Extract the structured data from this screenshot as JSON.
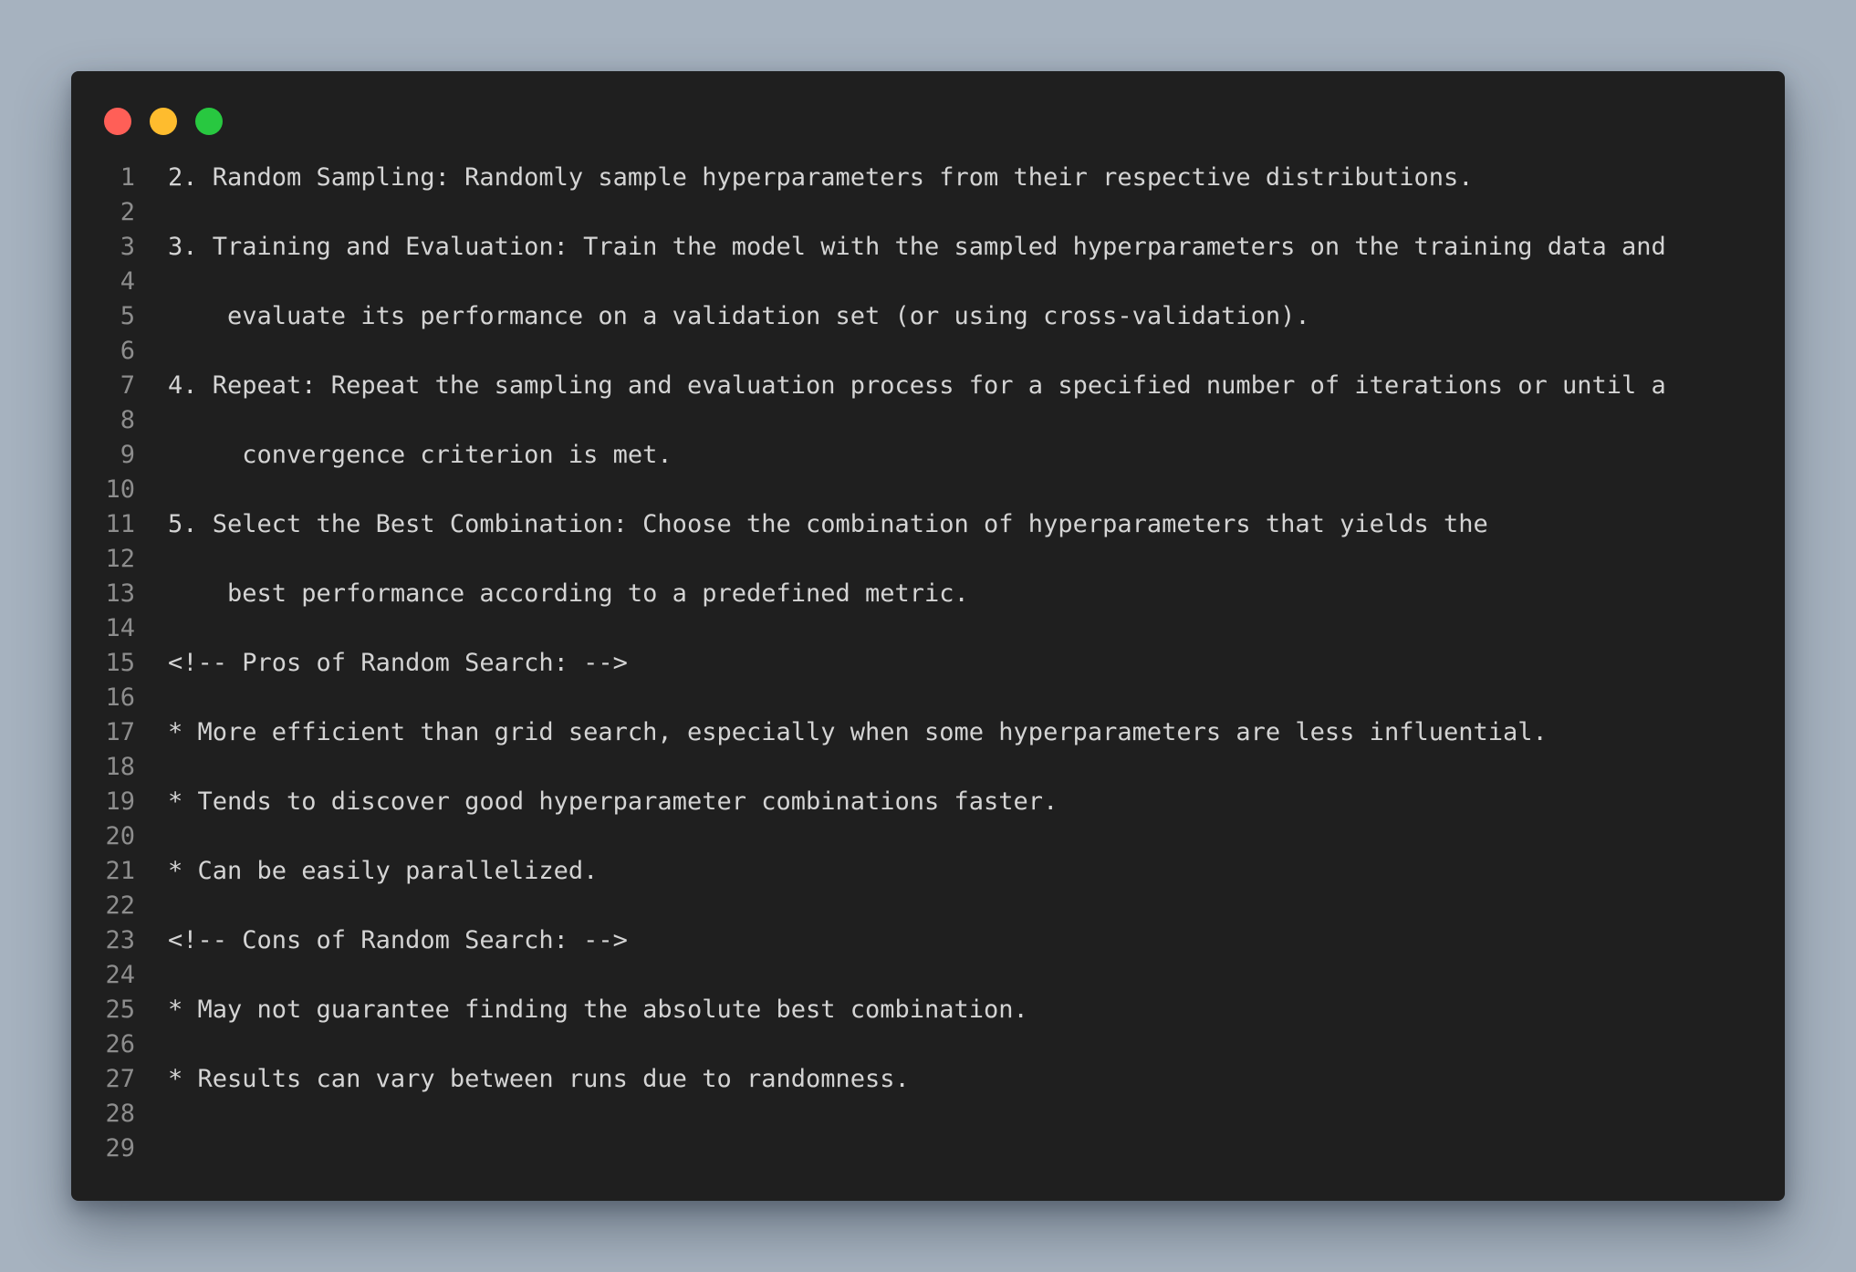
{
  "window": {
    "controls": [
      {
        "name": "close",
        "color": "#ff5f57"
      },
      {
        "name": "minimize",
        "color": "#febc2e"
      },
      {
        "name": "maximize",
        "color": "#28c840"
      }
    ]
  },
  "code": {
    "lines": [
      {
        "number": "1",
        "text": "2. Random Sampling: Randomly sample hyperparameters from their respective distributions."
      },
      {
        "number": "2",
        "text": ""
      },
      {
        "number": "3",
        "text": "3. Training and Evaluation: Train the model with the sampled hyperparameters on the training data and"
      },
      {
        "number": "4",
        "text": ""
      },
      {
        "number": "5",
        "text": "    evaluate its performance on a validation set (or using cross-validation)."
      },
      {
        "number": "6",
        "text": ""
      },
      {
        "number": "7",
        "text": "4. Repeat: Repeat the sampling and evaluation process for a specified number of iterations or until a"
      },
      {
        "number": "8",
        "text": ""
      },
      {
        "number": "9",
        "text": "     convergence criterion is met."
      },
      {
        "number": "10",
        "text": ""
      },
      {
        "number": "11",
        "text": "5. Select the Best Combination: Choose the combination of hyperparameters that yields the"
      },
      {
        "number": "12",
        "text": ""
      },
      {
        "number": "13",
        "text": "    best performance according to a predefined metric."
      },
      {
        "number": "14",
        "text": ""
      },
      {
        "number": "15",
        "text": "<!-- Pros of Random Search: -->"
      },
      {
        "number": "16",
        "text": ""
      },
      {
        "number": "17",
        "text": "* More efficient than grid search, especially when some hyperparameters are less influential."
      },
      {
        "number": "18",
        "text": ""
      },
      {
        "number": "19",
        "text": "* Tends to discover good hyperparameter combinations faster."
      },
      {
        "number": "20",
        "text": ""
      },
      {
        "number": "21",
        "text": "* Can be easily parallelized."
      },
      {
        "number": "22",
        "text": ""
      },
      {
        "number": "23",
        "text": "<!-- Cons of Random Search: -->"
      },
      {
        "number": "24",
        "text": ""
      },
      {
        "number": "25",
        "text": "* May not guarantee finding the absolute best combination."
      },
      {
        "number": "26",
        "text": ""
      },
      {
        "number": "27",
        "text": "* Results can vary between runs due to randomness."
      },
      {
        "number": "28",
        "text": ""
      },
      {
        "number": "29",
        "text": ""
      }
    ]
  }
}
